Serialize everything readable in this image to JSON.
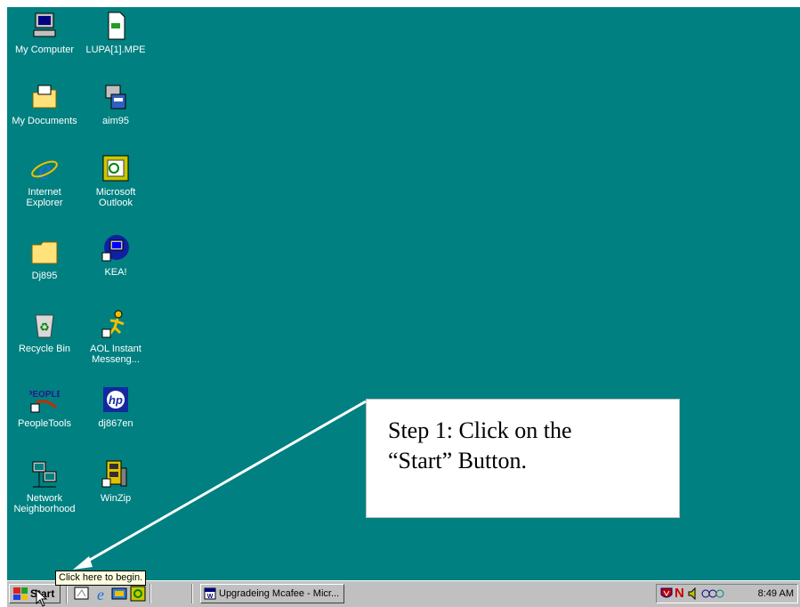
{
  "desktop": {
    "background": "#008080",
    "icons": [
      {
        "label": "My Computer",
        "icon": "my-computer-icon"
      },
      {
        "label": "LUPA[1].MPE",
        "icon": "file-icon"
      },
      {
        "label": "My Documents",
        "icon": "folder-icon"
      },
      {
        "label": "aim95",
        "icon": "aim-installer-icon"
      },
      {
        "label": "Internet\nExplorer",
        "icon": "internet-explorer-icon"
      },
      {
        "label": "Microsoft\nOutlook",
        "icon": "outlook-icon"
      },
      {
        "label": "Dj895",
        "icon": "folder-icon"
      },
      {
        "label": "KEA!",
        "icon": "kea-shortcut-icon"
      },
      {
        "label": "Recycle Bin",
        "icon": "recycle-bin-icon"
      },
      {
        "label": "AOL Instant\nMesseng...",
        "icon": "aol-running-man-icon"
      },
      {
        "label": "PeopleTools",
        "icon": "peopletools-icon"
      },
      {
        "label": "dj867en",
        "icon": "hp-icon"
      },
      {
        "label": "Network\nNeighborhood",
        "icon": "network-neighborhood-icon"
      },
      {
        "label": "WinZip",
        "icon": "winzip-icon"
      }
    ]
  },
  "callout": {
    "text": "Step 1: Click on the\n“Start” Button."
  },
  "tooltip": {
    "text": "Click here to begin."
  },
  "taskbar": {
    "start_label": "Start",
    "quick_launch": [
      "show-desktop-icon",
      "internet-explorer-icon",
      "channels-icon",
      "outlook-express-icon"
    ],
    "task_item": "Upgradeing Mcafee - Micr...",
    "tray_icons": [
      "mcafee-shield-icon",
      "norton-icon",
      "speaker-icon",
      "network-icon"
    ],
    "clock": "8:49 AM"
  }
}
